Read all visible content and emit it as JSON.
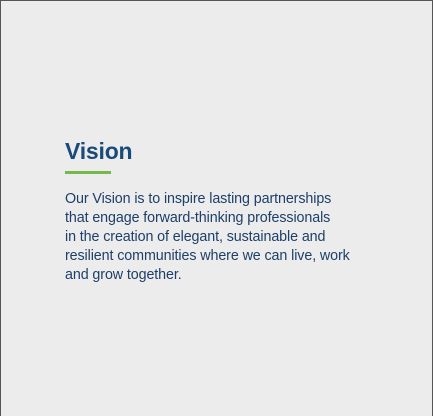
{
  "section": {
    "title": "Vision",
    "accent_color": "#74b94b",
    "title_color": "#1a4a7a",
    "text_color": "#1d3f68",
    "background_color": "#ececec",
    "body_lines": [
      "Our Vision is to inspire lasting partnerships",
      "that engage forward-thinking professionals",
      "in the creation of elegant, sustainable and",
      "resilient communities where we can live, work",
      "and grow together."
    ]
  }
}
